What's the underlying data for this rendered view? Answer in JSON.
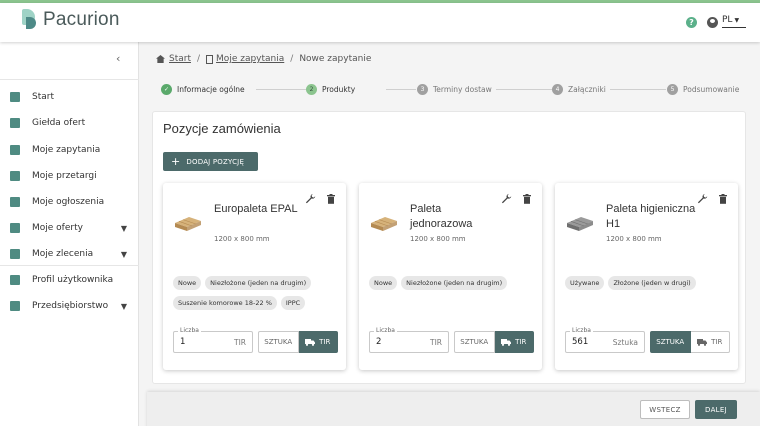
{
  "app": {
    "logo_text": "Pacurion"
  },
  "header": {
    "language": "PL"
  },
  "colors": {
    "accent": "#4c6a6a",
    "success": "#5aa96b",
    "brand_light": "#9fd3c6",
    "brand_dark": "#4d8a87"
  },
  "sidebar": {
    "items": [
      {
        "label": "Start",
        "icon": "home-icon"
      },
      {
        "label": "Giełda ofert",
        "icon": "store-icon"
      },
      {
        "label": "Moje zapytania",
        "icon": "clipboard-icon"
      },
      {
        "label": "Moje przetargi",
        "icon": "gavel-icon"
      },
      {
        "label": "Moje ogłoszenia",
        "icon": "book-icon"
      },
      {
        "label": "Moje oferty",
        "icon": "tag-icon",
        "expandable": true
      },
      {
        "label": "Moje zlecenia",
        "icon": "calendar-icon",
        "expandable": true
      },
      {
        "label": "Profil użytkownika",
        "icon": "person-icon"
      },
      {
        "label": "Przedsiębiorstwo",
        "icon": "building-icon",
        "expandable": true
      }
    ]
  },
  "breadcrumb": {
    "home": "Start",
    "parent": "Moje zapytania",
    "current": "Nowe zapytanie"
  },
  "stepper": {
    "steps": [
      {
        "num": "1",
        "label": "Informacje ogólne",
        "state": "done"
      },
      {
        "num": "2",
        "label": "Produkty",
        "state": "active"
      },
      {
        "num": "3",
        "label": "Terminy dostaw",
        "state": "todo"
      },
      {
        "num": "4",
        "label": "Załączniki",
        "state": "todo"
      },
      {
        "num": "5",
        "label": "Podsumowanie",
        "state": "todo"
      }
    ]
  },
  "panel": {
    "title": "Pozycje zamówienia",
    "add_button": "DODAJ POZYCJĘ"
  },
  "products": [
    {
      "name": "Europaleta EPAL",
      "dims": "1200 x 800 mm",
      "tags": [
        "Nowe",
        "Niezłożone (jeden na drugim)",
        "Suszenie komorowe 18-22 %",
        "IPPC"
      ],
      "qty_label": "Liczba",
      "qty": "1",
      "unit": "TIR",
      "unit_options": [
        "SZTUKA",
        "TIR"
      ],
      "selected_unit": "TIR"
    },
    {
      "name": "Paleta jednorazowa",
      "dims": "1200 x 800 mm",
      "tags": [
        "Nowe",
        "Niezłożone (jeden na drugim)"
      ],
      "qty_label": "Liczba",
      "qty": "2",
      "unit": "TIR",
      "unit_options": [
        "SZTUKA",
        "TIR"
      ],
      "selected_unit": "TIR"
    },
    {
      "name": "Paleta higieniczna H1",
      "dims": "1200 x 800 mm",
      "tags": [
        "Używane",
        "Złożone (jeden w drugi)"
      ],
      "qty_label": "Liczba",
      "qty": "561",
      "unit": "Sztuka",
      "unit_options": [
        "SZTUKA",
        "TIR"
      ],
      "selected_unit": "SZTUKA"
    }
  ],
  "footer": {
    "back": "WSTECZ",
    "next": "DALEJ"
  }
}
